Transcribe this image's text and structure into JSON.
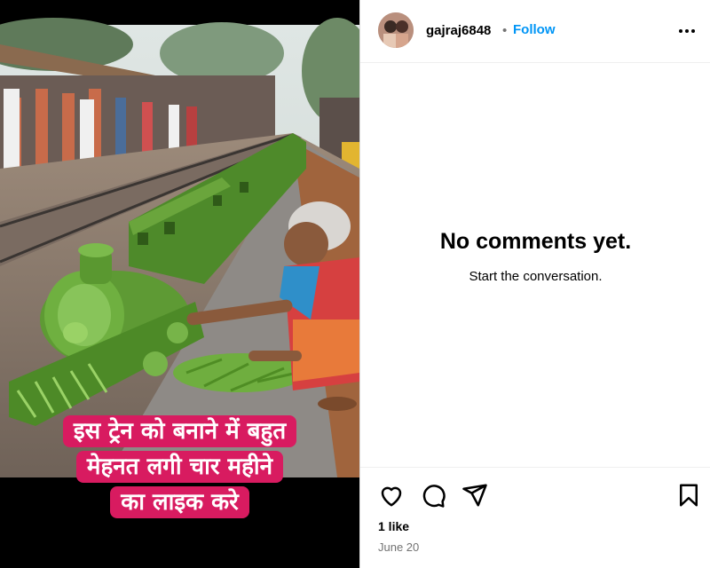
{
  "post": {
    "caption_lines": [
      "इस ट्रेन को बनाने में बहुत",
      "मेहनत लगी चार महीने",
      "का लाइक करे"
    ]
  },
  "header": {
    "username": "gajraj6848",
    "separator": "•",
    "follow_label": "Follow",
    "more_icon": "more-horizontal-icon"
  },
  "comments": {
    "empty_title": "No comments yet.",
    "empty_subtitle": "Start the conversation."
  },
  "actions": {
    "icons": [
      "heart-icon",
      "comment-icon",
      "share-icon",
      "bookmark-icon"
    ],
    "likes": "1 like",
    "date": "June 20"
  },
  "colors": {
    "caption_bg": "#d81b60",
    "link": "#0095f6",
    "muted": "#737373"
  }
}
